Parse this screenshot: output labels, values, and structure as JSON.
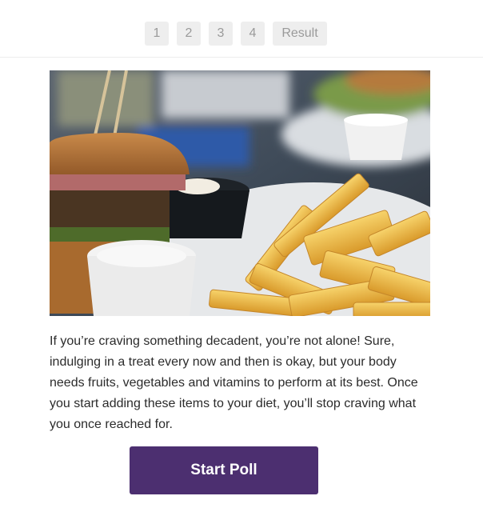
{
  "steps": [
    {
      "label": "1"
    },
    {
      "label": "2"
    },
    {
      "label": "3"
    },
    {
      "label": "4"
    },
    {
      "label": "Result"
    }
  ],
  "hero": {
    "image": "burger-and-fries-photo",
    "description_icons": [
      "burger",
      "fries",
      "dip-cup",
      "sauce-cup"
    ]
  },
  "body_text": "If you’re craving something decadent, you’re not alone! Sure, indulging in a treat every now and then is okay, but your body needs fruits, vegetables and vitamins to perform at its best. Once you start adding these items to your diet, you’ll stop craving what you once reached for.",
  "primary_button": {
    "label": "Start Poll",
    "color": "#4c2f70"
  }
}
